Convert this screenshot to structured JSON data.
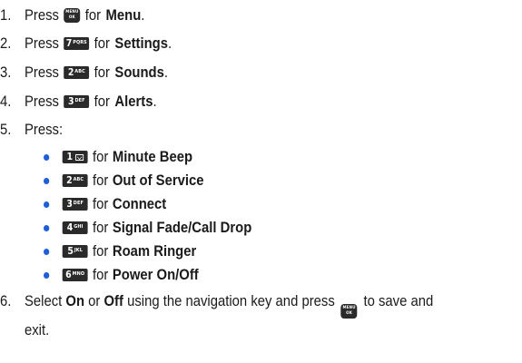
{
  "steps": [
    {
      "num": "1.",
      "pre": "Press",
      "key": "menu",
      "key_lines": [
        "MENU",
        "OK"
      ],
      "mid": "for",
      "target": "Menu",
      "post": "."
    },
    {
      "num": "2.",
      "pre": "Press",
      "key_digit": "7",
      "key_letters": "PQRS",
      "mid": "for",
      "target": "Settings",
      "post": "."
    },
    {
      "num": "3.",
      "pre": "Press",
      "key_digit": "2",
      "key_letters": "ABC",
      "mid": "for",
      "target": "Sounds",
      "post": "."
    },
    {
      "num": "4.",
      "pre": "Press",
      "key_digit": "3",
      "key_letters": "DEF",
      "mid": "for",
      "target": "Alerts",
      "post": "."
    },
    {
      "num": "5.",
      "pre": "Press:"
    }
  ],
  "sub_options": [
    {
      "key_digit": "1",
      "mid": "for",
      "target": "Minute Beep"
    },
    {
      "key_digit": "2",
      "key_letters": "ABC",
      "mid": "for",
      "target": "Out of Service"
    },
    {
      "key_digit": "3",
      "key_letters": "DEF",
      "mid": "for",
      "target": "Connect"
    },
    {
      "key_digit": "4",
      "key_letters": "GHI",
      "mid": "for",
      "target": "Signal Fade/Call Drop"
    },
    {
      "key_digit": "5",
      "key_letters": "JKL",
      "mid": "for",
      "target": "Roam Ringer"
    },
    {
      "key_digit": "6",
      "key_letters": "MNO",
      "mid": "for",
      "target": "Power On/Off"
    }
  ],
  "final_step": {
    "num": "6.",
    "text_a": "Select",
    "opt_on": "On",
    "text_or": "or",
    "opt_off": "Off",
    "text_b": "using the navigation key and press",
    "key_lines": [
      "MENU",
      "OK"
    ],
    "text_c": "to save and",
    "text_d": "exit."
  },
  "colors": {
    "bullet": "#1f5fd6",
    "key_bg": "#2a2a2a",
    "text": "#1a1a1a"
  }
}
